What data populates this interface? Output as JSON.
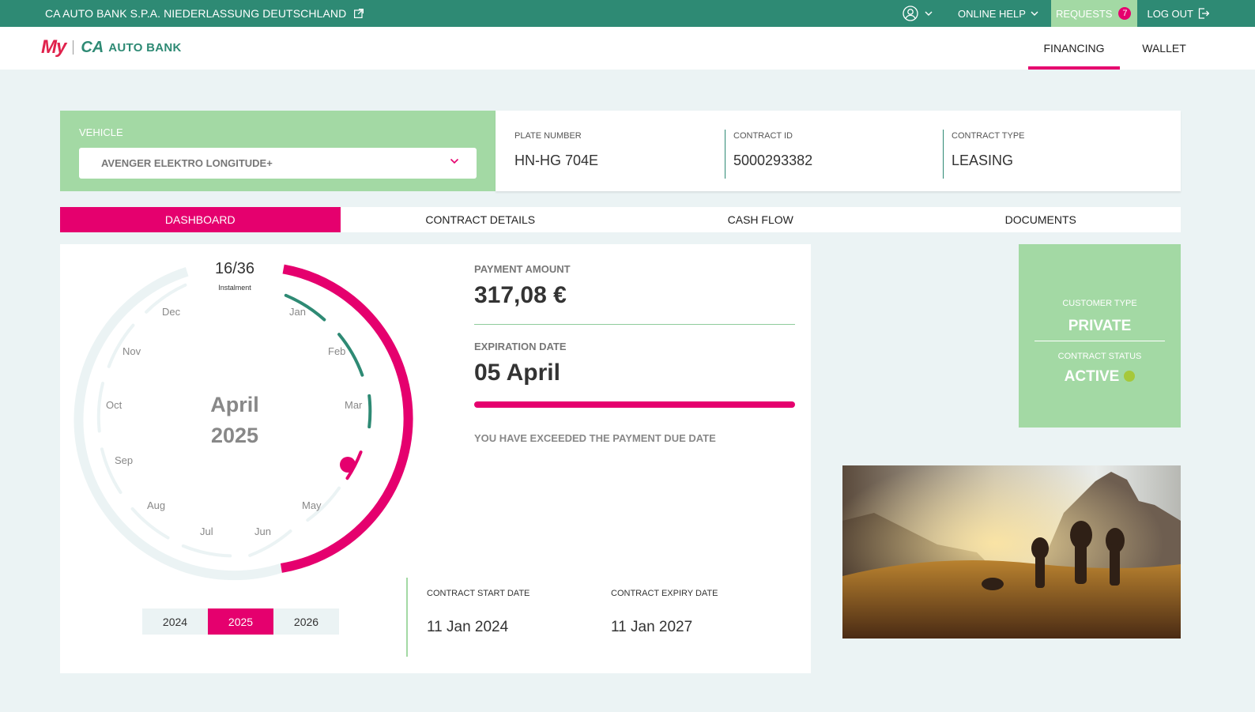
{
  "topbar": {
    "bank_name": "CA AUTO BANK S.P.A. NIEDERLASSUNG DEUTSCHLAND",
    "online_help": "ONLINE HELP",
    "requests": "REQUESTS",
    "requests_count": "7",
    "logout": "LOG OUT"
  },
  "header": {
    "logo_my": "My",
    "logo_ca": "CA",
    "logo_text": "AUTO BANK",
    "nav": [
      "FINANCING",
      "WALLET"
    ]
  },
  "vehicle": {
    "label": "VEHICLE",
    "selected": "AVENGER ELEKTRO LONGITUDE+"
  },
  "contract_info": {
    "plate_label": "PLATE NUMBER",
    "plate_value": "HN-HG 704E",
    "id_label": "CONTRACT ID",
    "id_value": "5000293382",
    "type_label": "CONTRACT TYPE",
    "type_value": "LEASING"
  },
  "tabs": [
    "DASHBOARD",
    "CONTRACT DETAILS",
    "CASH FLOW",
    "DOCUMENTS"
  ],
  "dashboard": {
    "instalment": "16/36",
    "instalment_label": "Instalment",
    "months": [
      "Jan",
      "Feb",
      "Mar",
      "May",
      "Jun",
      "Jul",
      "Aug",
      "Sep",
      "Oct",
      "Nov",
      "Dec"
    ],
    "center_month": "April",
    "center_year": "2025",
    "years": [
      "2024",
      "2025",
      "2026"
    ],
    "selected_year": "2025",
    "payment_label": "PAYMENT AMOUNT",
    "payment_amount": "317,08 €",
    "expiration_label": "EXPIRATION DATE",
    "expiration_date": "05 April",
    "warning": "YOU HAVE EXCEEDED THE PAYMENT DUE DATE",
    "start_label": "CONTRACT START DATE",
    "start_date": "11 Jan 2024",
    "expiry_label": "CONTRACT EXPIRY DATE",
    "expiry_date": "11 Jan 2027"
  },
  "customer": {
    "type_label": "CUSTOMER TYPE",
    "type_value": "PRIVATE",
    "status_label": "CONTRACT STATUS",
    "status_value": "ACTIVE"
  },
  "colors": {
    "brand_green": "#2e8a74",
    "light_green": "#a3d9a4",
    "accent_pink": "#e5006e",
    "background": "#ebf3f4"
  }
}
